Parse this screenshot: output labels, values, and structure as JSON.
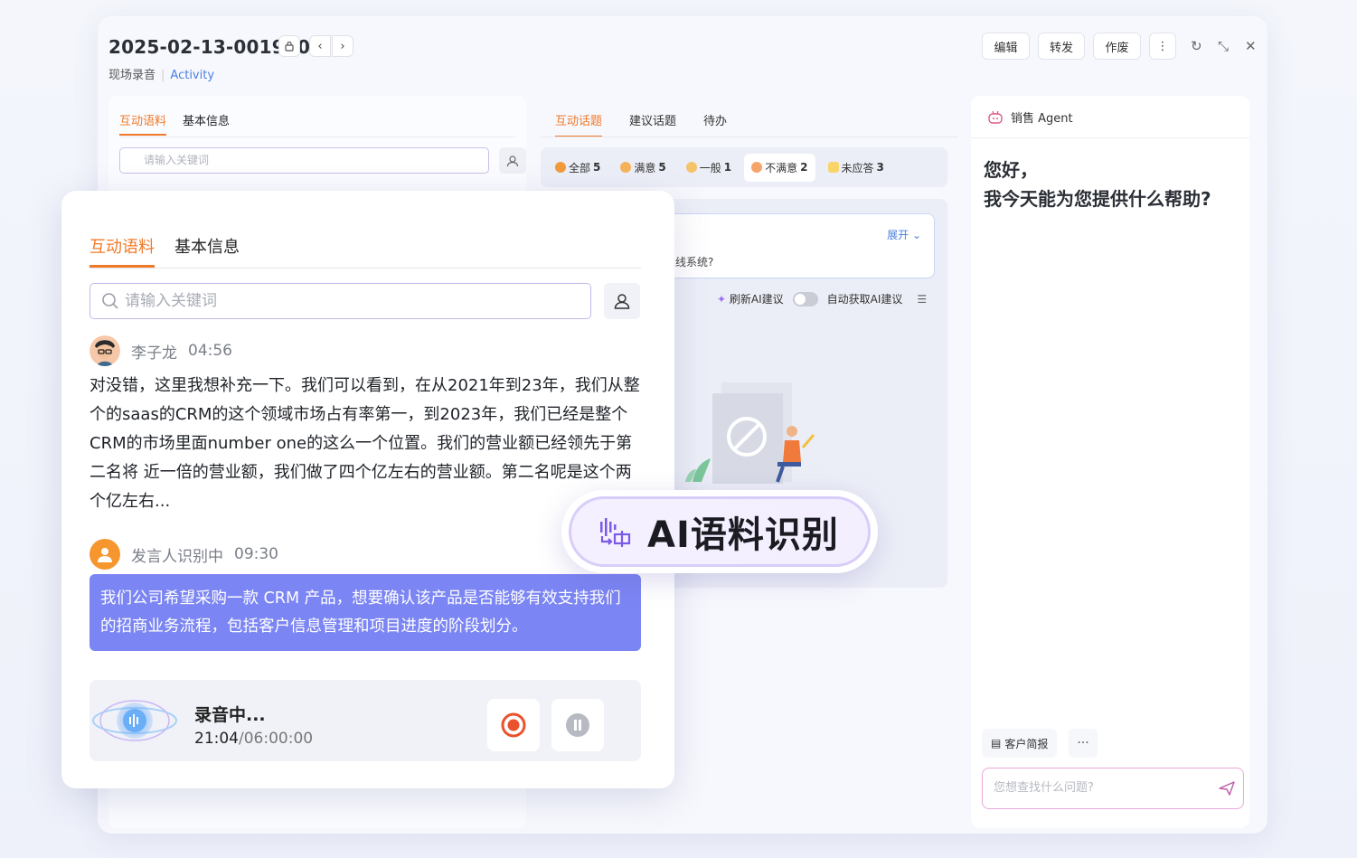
{
  "header": {
    "title": "2025-02-13-001960",
    "subtitle_type": "现场录音",
    "subtitle_link": "Activity",
    "buttons": {
      "edit": "编辑",
      "forward": "转发",
      "void": "作废"
    }
  },
  "left_panel": {
    "tabs": [
      "互动语料",
      "基本信息"
    ],
    "search_placeholder": "请输入关键词"
  },
  "middle_panel": {
    "tabs": [
      "互动话题",
      "建议话题",
      "待办"
    ],
    "filters": [
      {
        "label": "全部",
        "count": "5"
      },
      {
        "label": "满意",
        "count": "5"
      },
      {
        "label": "一般",
        "count": "1"
      },
      {
        "label": "不满意",
        "count": "2"
      },
      {
        "label": "未应答",
        "count": "3"
      }
    ],
    "expand_label": "展开",
    "question": "您预计什么时候上线系统?",
    "refresh_ai": "刷新AI建议",
    "auto_ai": "自动获取AI建议"
  },
  "agent": {
    "title": "销售 Agent",
    "greeting_line1": "您好，",
    "greeting_line2": "我今天能为您提供什么帮助?",
    "brief_label": "客户简报",
    "input_placeholder": "您想查找什么问题?"
  },
  "overlay": {
    "tabs": [
      "互动语料",
      "基本信息"
    ],
    "search_placeholder": "请输入关键词",
    "speaker1": {
      "name": "李子龙",
      "time": "04:56"
    },
    "speech1": "对没错，这里我想补充一下。我们可以看到，在从2021年到23年，我们从整个的saas的CRM的这个领域市场占有率第一，到2023年，我们已经是整个CRM的市场里面number one的这么一个位置。我们的营业额已经领先于第二名将 近一倍的营业额，我们做了四个亿左右的营业额。第二名呢是这个两个亿左右...",
    "speaker2": {
      "name": "发言人识别中",
      "time": "09:30"
    },
    "speech2": "我们公司希望采购一款 CRM 产品，想要确认该产品是否能够有效支持我们的招商业务流程，包括客户信息管理和项目进度的阶段划分。",
    "recording_title": "录音中...",
    "recording_elapsed": "21:04",
    "recording_total": "/06:00:00"
  },
  "badge": {
    "label": "AI语料识别"
  },
  "colors": {
    "accent": "#f07a2a",
    "bubble": "#7b85f3",
    "link": "#4a7fe0"
  }
}
